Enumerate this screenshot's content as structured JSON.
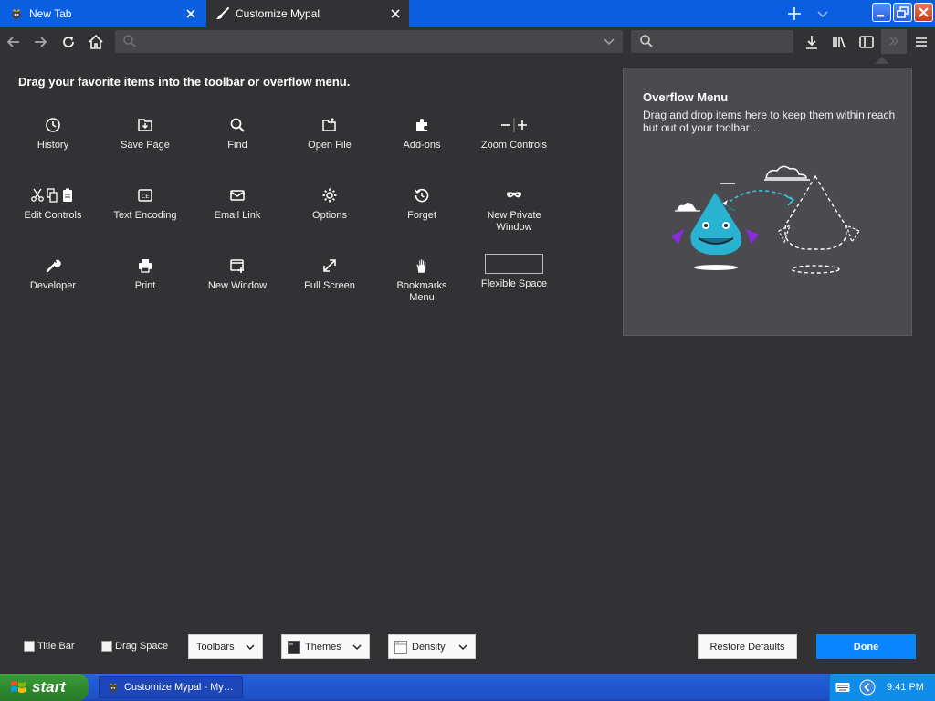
{
  "tabs": [
    {
      "label": "New Tab",
      "icon": "mypal-logo-icon"
    },
    {
      "label": "Customize Mypal",
      "icon": "paintbrush-icon"
    }
  ],
  "palette": {
    "heading": "Drag your favorite items into the toolbar or overflow menu.",
    "items": [
      {
        "label": "History",
        "icon": "history-icon"
      },
      {
        "label": "Save Page",
        "icon": "save-page-icon"
      },
      {
        "label": "Find",
        "icon": "find-icon"
      },
      {
        "label": "Open File",
        "icon": "open-file-icon"
      },
      {
        "label": "Add-ons",
        "icon": "addons-icon"
      },
      {
        "label": "Zoom Controls",
        "icon": "zoom-controls-icon"
      },
      {
        "label": "Edit Controls",
        "icon": "edit-controls-icon"
      },
      {
        "label": "Text Encoding",
        "icon": "text-encoding-icon"
      },
      {
        "label": "Email Link",
        "icon": "email-link-icon"
      },
      {
        "label": "Options",
        "icon": "options-icon"
      },
      {
        "label": "Forget",
        "icon": "forget-icon"
      },
      {
        "label": "New Private Window",
        "icon": "private-window-icon"
      },
      {
        "label": "Developer",
        "icon": "developer-icon"
      },
      {
        "label": "Print",
        "icon": "print-icon"
      },
      {
        "label": "New Window",
        "icon": "new-window-icon"
      },
      {
        "label": "Full Screen",
        "icon": "full-screen-icon"
      },
      {
        "label": "Bookmarks Menu",
        "icon": "bookmarks-menu-icon"
      },
      {
        "label": "Flexible Space",
        "icon": "flexible-space-icon"
      }
    ]
  },
  "overflow": {
    "title": "Overflow Menu",
    "description": "Drag and drop items here to keep them within reach but out of your toolbar…"
  },
  "footer": {
    "title_bar": "Title Bar",
    "drag_space": "Drag Space",
    "toolbars": "Toolbars",
    "themes": "Themes",
    "density": "Density",
    "restore_defaults": "Restore Defaults",
    "done": "Done"
  },
  "taskbar": {
    "start": "start",
    "task": "Customize Mypal - My…",
    "clock": "9:41 PM"
  },
  "colors": {
    "accent": "#0a84ff",
    "background": "#323234",
    "panel": "#4a4a4f"
  }
}
